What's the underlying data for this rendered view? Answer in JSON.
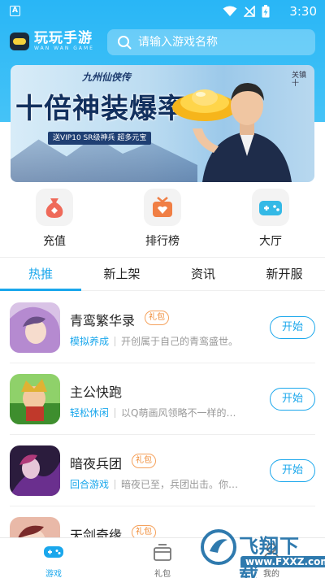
{
  "status_bar": {
    "time": "3:30",
    "notification_letter": "A"
  },
  "app": {
    "title": "玩玩手游",
    "subtitle": "WAN WAN GAME"
  },
  "search": {
    "placeholder": "请输入游戏名称"
  },
  "banner": {
    "game_logo": "九州仙侠传",
    "headline": "十倍神装爆率",
    "strip_text": "送VIP10 SR级神兵 超多元宝",
    "side_tag": "关镇十"
  },
  "quick_actions": [
    {
      "label": "充值",
      "icon": "money-bag-icon",
      "color": "#ef6a5a"
    },
    {
      "label": "排行榜",
      "icon": "ranking-icon",
      "color": "#f07f45"
    },
    {
      "label": "大厅",
      "icon": "gamepad-icon",
      "color": "#34b9e6"
    }
  ],
  "tabs": [
    {
      "label": "热推",
      "active": true
    },
    {
      "label": "新上架",
      "active": false
    },
    {
      "label": "资讯",
      "active": false
    },
    {
      "label": "新开服",
      "active": false
    }
  ],
  "games": [
    {
      "name": "青鸾繁华录",
      "gift": "礼包",
      "category": "模拟养成",
      "desc": "开创属于自己的青鸾盛世。",
      "button": "开始"
    },
    {
      "name": "主公快跑",
      "gift": "",
      "category": "轻松休闲",
      "desc": "以Q萌画风领略不一样的三...",
      "button": "开始"
    },
    {
      "name": "暗夜兵团",
      "gift": "礼包",
      "category": "回合游戏",
      "desc": "暗夜已至，兵团出击。你，...",
      "button": "开始"
    },
    {
      "name": "天剑奇缘",
      "gift": "礼包",
      "category": "",
      "desc": "",
      "button": ""
    }
  ],
  "bottom_nav": [
    {
      "label": "游戏",
      "active": true
    },
    {
      "label": "礼包",
      "active": false
    },
    {
      "label": "我的",
      "active": false
    }
  ],
  "watermark": {
    "text": "飞翔下载",
    "url": "www.FXXZ.com"
  },
  "colors": {
    "accent": "#1aa7ec",
    "header": "#29b6f6",
    "gift": "#f08a33"
  }
}
